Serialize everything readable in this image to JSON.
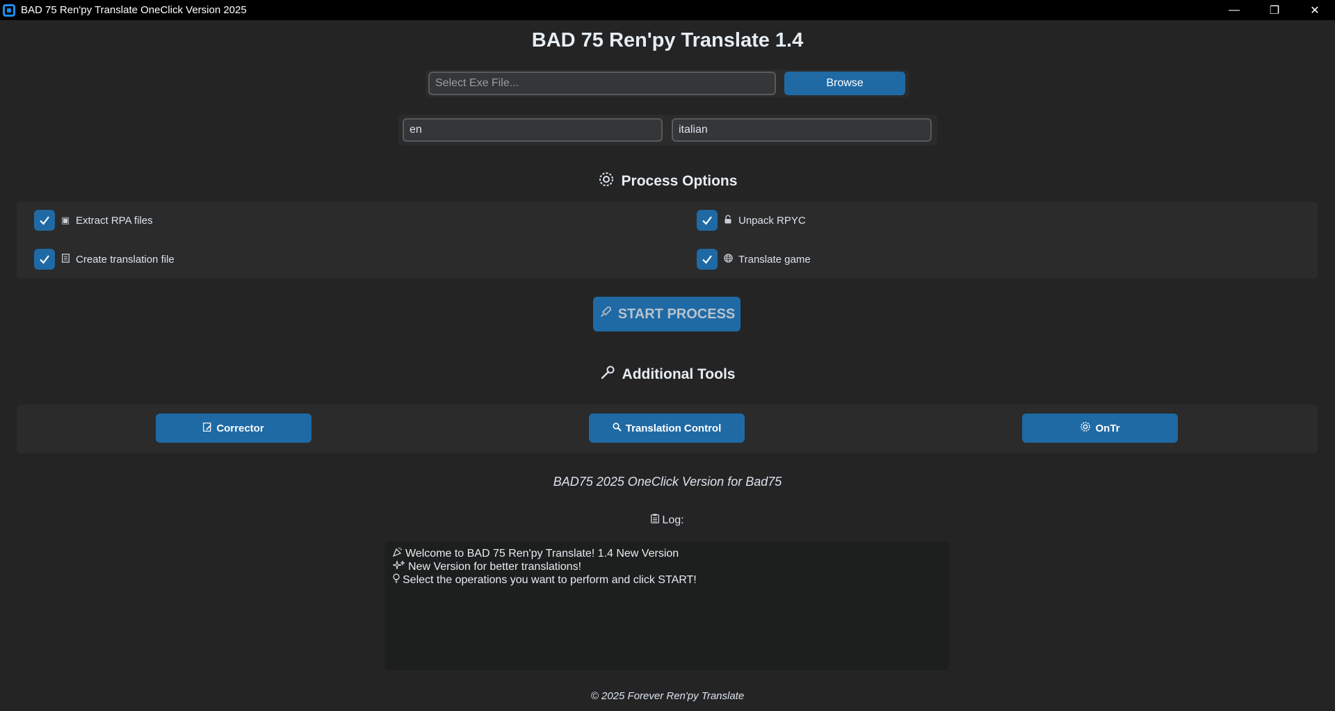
{
  "window": {
    "title": "BAD 75 Ren'py Translate OneClick Version 2025",
    "minimize": "—",
    "restore": "❐",
    "close": "✕"
  },
  "header": {
    "title": "BAD 75 Ren'py Translate 1.4"
  },
  "file_select": {
    "placeholder": "Select Exe File...",
    "value": "",
    "browse_label": "Browse"
  },
  "languages": {
    "source": "en",
    "target": "italian"
  },
  "process_options": {
    "title": "Process Options",
    "title_icon": "gear-icon",
    "items": [
      {
        "label": "Extract RPA files",
        "icon": "package-icon",
        "checked": true
      },
      {
        "label": "Unpack RPYC",
        "icon": "unlock-icon",
        "checked": true
      },
      {
        "label": "Create translation file",
        "icon": "document-icon",
        "checked": true
      },
      {
        "label": "Translate game",
        "icon": "globe-icon",
        "checked": true
      }
    ]
  },
  "start_button": {
    "label": "START PROCESS",
    "icon": "rocket-icon"
  },
  "additional_tools": {
    "title": "Additional Tools",
    "title_icon": "wrench-icon",
    "buttons": [
      {
        "label": "Corrector",
        "icon": "edit-icon"
      },
      {
        "label": "Translation Control",
        "icon": "search-icon"
      },
      {
        "label": "OnTr",
        "icon": "gear-icon"
      }
    ]
  },
  "version_text": "BAD75 2025 OneClick Version for Bad75",
  "log": {
    "label": "Log:",
    "label_icon": "clipboard-icon",
    "lines": [
      {
        "icon": "party-icon",
        "text": "Welcome to BAD 75 Ren'py Translate! 1.4 New Version"
      },
      {
        "icon": "sparkle-icon",
        "text": "New Version for better translations!"
      },
      {
        "icon": "lightbulb-icon",
        "text": "Select the operations you want to perform and click START!"
      }
    ]
  },
  "footer": "© 2025 Forever Ren'py Translate",
  "colors": {
    "background": "#242424",
    "frame": "#2b2b2b",
    "accent": "#1f6aa5",
    "titlebar": "#000000"
  }
}
